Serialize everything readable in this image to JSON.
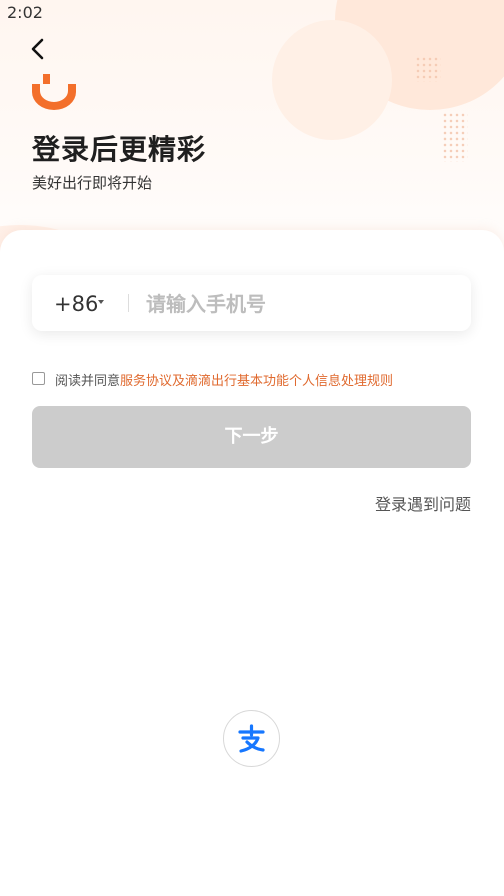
{
  "status_bar": {
    "time": "2:02"
  },
  "header": {
    "back_icon": "chevron-left-icon",
    "logo_icon": "didi-logo-icon",
    "title": "登录后更精彩",
    "subtitle": "美好出行即将开始"
  },
  "form": {
    "country_code": "+86",
    "phone_placeholder": "请输入手机号",
    "phone_value": "",
    "agreement": {
      "prefix": "阅读并同意",
      "service_link": "服务协议",
      "conjunction": "及",
      "privacy_link": "滴滴出行基本功能个人信息处理规则",
      "checked": false
    },
    "next_button": "下一步",
    "help_link": "登录遇到问题"
  },
  "third_party": {
    "alipay_icon": "alipay-icon"
  },
  "colors": {
    "accent": "#f36f2b",
    "link": "#e06a2f",
    "button_disabled": "#cccccc",
    "alipay": "#1677ff"
  }
}
